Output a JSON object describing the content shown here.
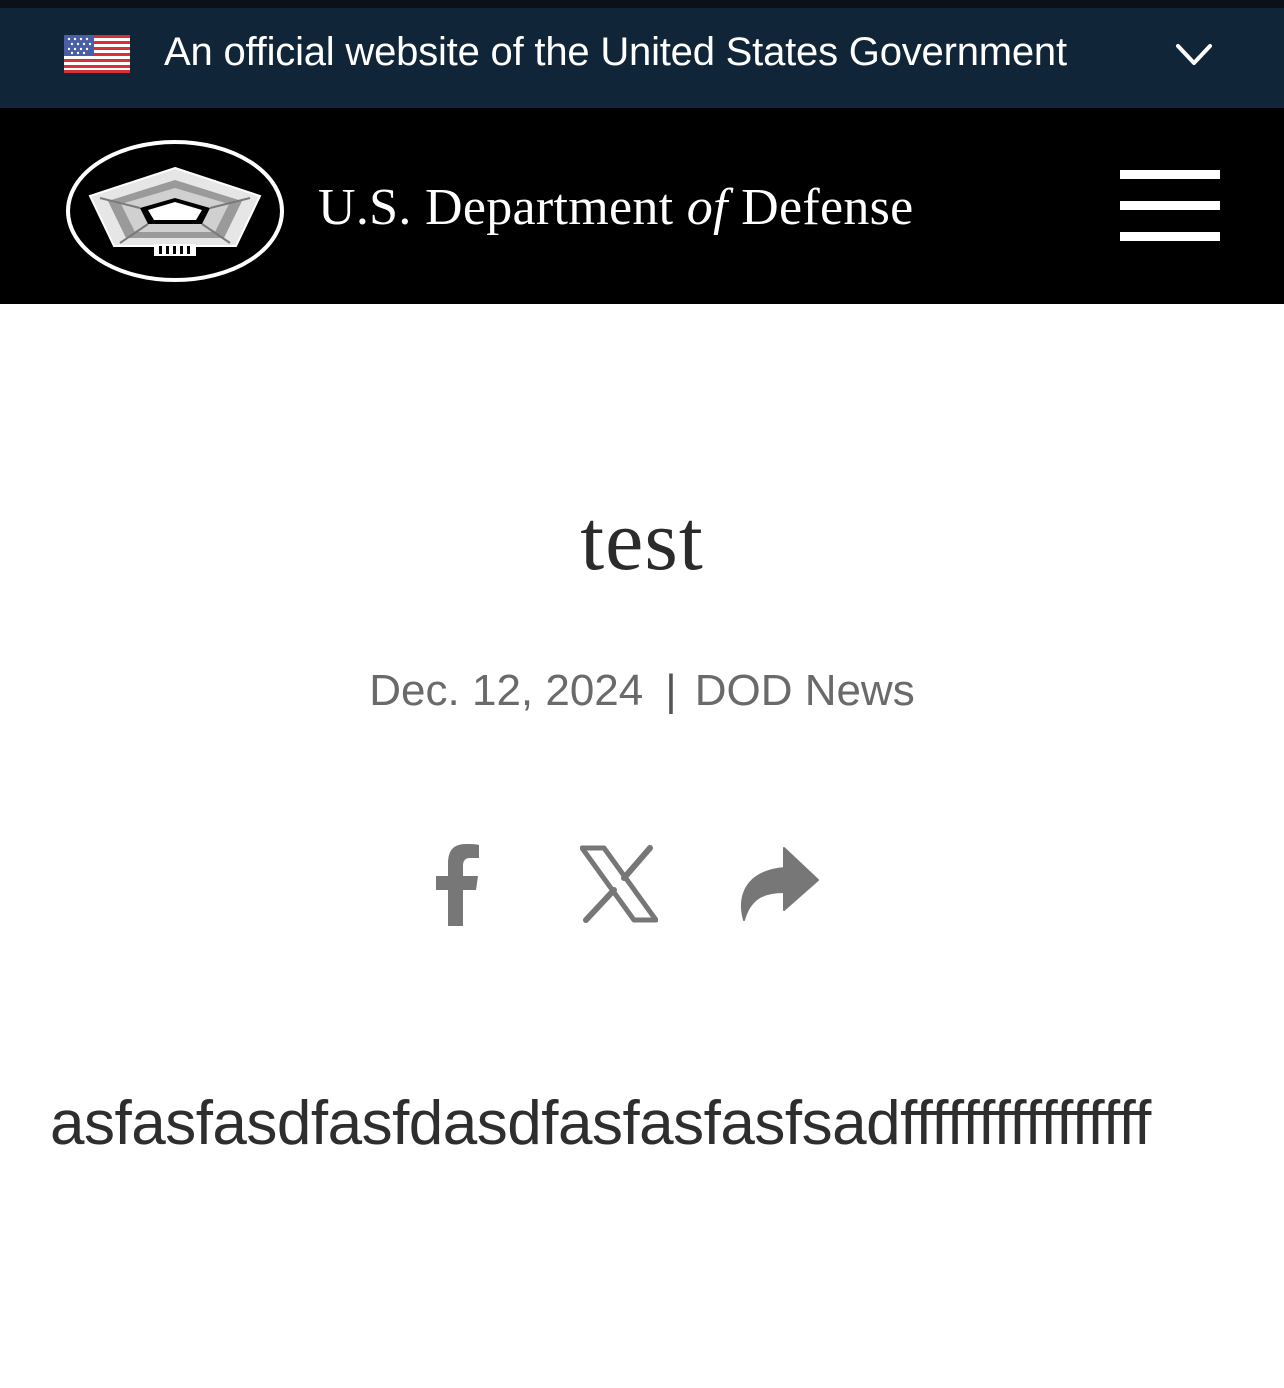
{
  "gov_banner": {
    "text": "An official website of the United States Government",
    "flag_icon": "us-flag-icon",
    "expand_icon": "chevron-down-icon",
    "background": "#112538"
  },
  "header": {
    "title_part1": "U.S. Department ",
    "title_of": "of",
    "title_part2": " Defense",
    "logo_icon": "pentagon-seal-icon",
    "menu_icon": "hamburger-menu-icon",
    "background": "#000000"
  },
  "article": {
    "title": "test",
    "date": "Dec. 12, 2024",
    "separator": "|",
    "source": "DOD News",
    "body": "asfasfasdfasfdasdfasfasfasfsadffffffffffffffff"
  },
  "share": {
    "facebook_icon": "facebook-icon",
    "x_icon": "x-icon",
    "forward_icon": "share-forward-icon",
    "icon_color": "#777777"
  }
}
